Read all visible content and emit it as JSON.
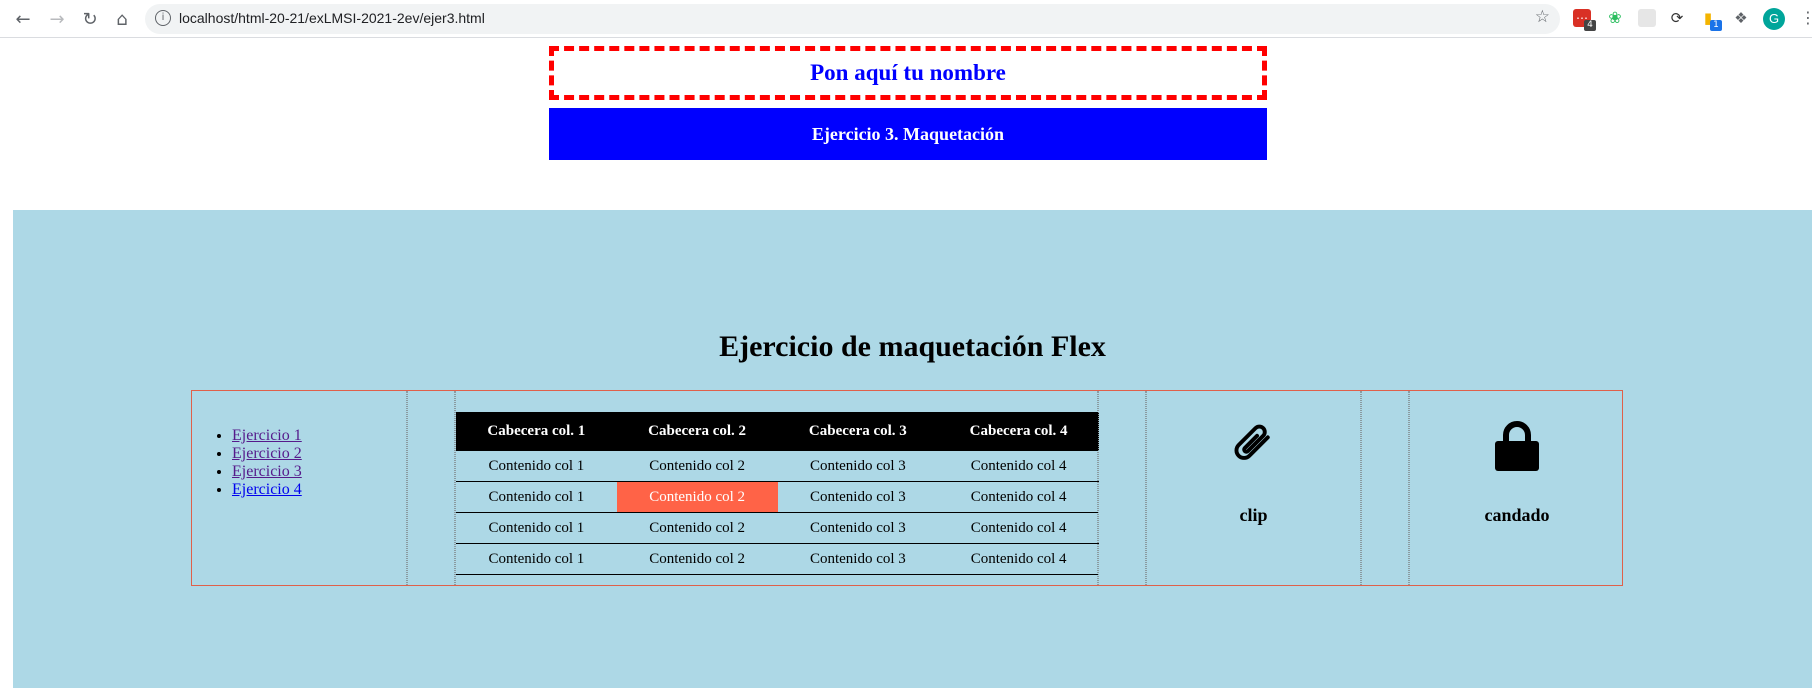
{
  "browser": {
    "url": "localhost/html-20-21/exLMSI-2021-2ev/ejer3.html",
    "extensions": [
      {
        "name": "todoist-icon",
        "badge": "4"
      },
      {
        "name": "evernote-icon",
        "badge": ""
      },
      {
        "name": "page-extension-icon",
        "badge": ""
      },
      {
        "name": "sync-icon",
        "badge": ""
      },
      {
        "name": "notes-icon",
        "badge": "1"
      }
    ],
    "avatar_letter": "G"
  },
  "header": {
    "name_placeholder": "Pon aquí tu nombre",
    "exercise_title": "Ejercicio 3. Maquetación"
  },
  "section": {
    "title": "Ejercicio de maquetación Flex"
  },
  "menu": {
    "links": [
      "Ejercicio 1",
      "Ejercicio 2",
      "Ejercicio 3",
      "Ejercicio 4"
    ]
  },
  "table": {
    "headers": [
      "Cabecera col. 1",
      "Cabecera col. 2",
      "Cabecera col. 3",
      "Cabecera col. 4"
    ],
    "rows": [
      [
        "Contenido col 1",
        "Contenido col 2",
        "Contenido col 3",
        "Contenido col 4"
      ],
      [
        "Contenido col 1",
        "Contenido col 2",
        "Contenido col 3",
        "Contenido col 4"
      ],
      [
        "Contenido col 1",
        "Contenido col 2",
        "Contenido col 3",
        "Contenido col 4"
      ],
      [
        "Contenido col 1",
        "Contenido col 2",
        "Contenido col 3",
        "Contenido col 4"
      ]
    ],
    "highlight_color": "#ff6347"
  },
  "cards": {
    "clip_label": "clip",
    "lock_label": "candado"
  },
  "colors": {
    "section_bg": "#add8e6",
    "header_bg": "#0000ff",
    "name_border": "#ff0000"
  }
}
